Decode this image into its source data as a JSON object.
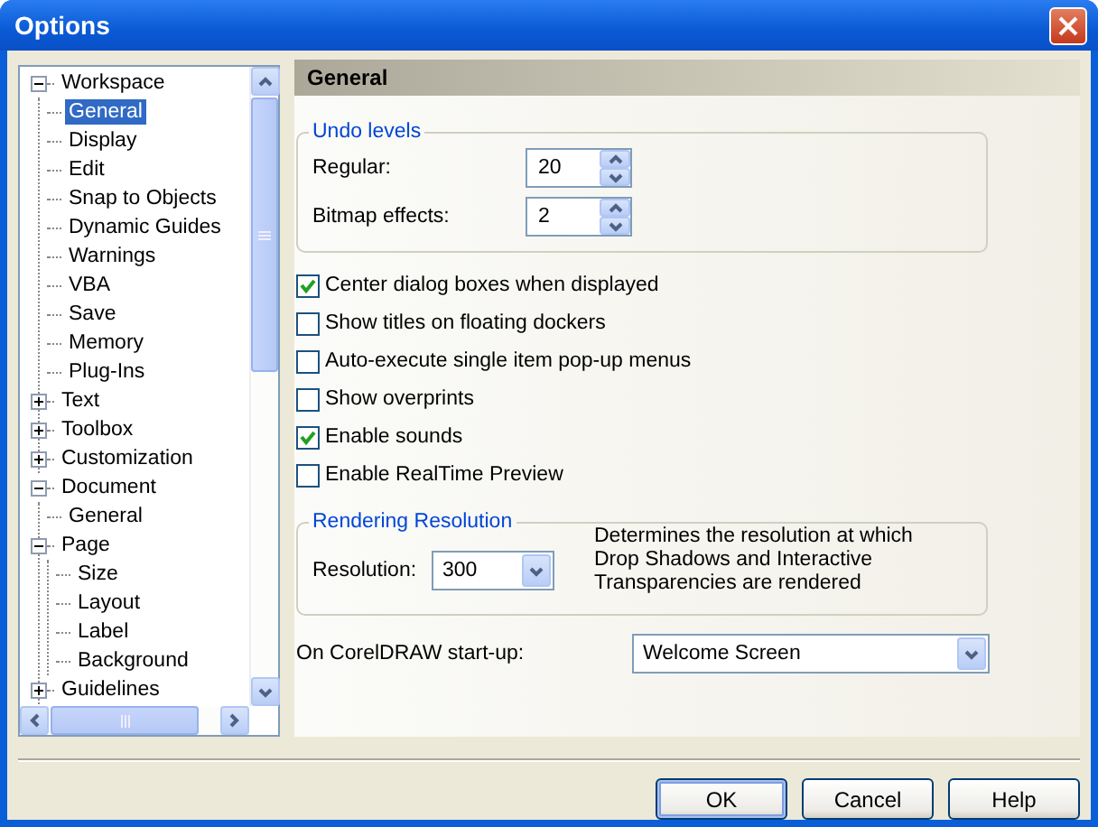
{
  "window": {
    "title": "Options"
  },
  "tree": [
    {
      "label": "Workspace",
      "expanded": true,
      "selected": false,
      "children": [
        {
          "label": "General",
          "selected": true
        },
        {
          "label": "Display",
          "selected": false
        },
        {
          "label": "Edit",
          "selected": false
        },
        {
          "label": "Snap to Objects",
          "selected": false
        },
        {
          "label": "Dynamic Guides",
          "selected": false
        },
        {
          "label": "Warnings",
          "selected": false
        },
        {
          "label": "VBA",
          "selected": false
        },
        {
          "label": "Save",
          "selected": false
        },
        {
          "label": "Memory",
          "selected": false
        },
        {
          "label": "Plug-Ins",
          "selected": false
        },
        {
          "label": "Text",
          "expanded": false,
          "selected": false
        },
        {
          "label": "Toolbox",
          "expanded": false,
          "selected": false
        },
        {
          "label": "Customization",
          "expanded": false,
          "selected": false
        }
      ]
    },
    {
      "label": "Document",
      "expanded": true,
      "selected": false,
      "children": [
        {
          "label": "General",
          "selected": false
        },
        {
          "label": "Page",
          "expanded": true,
          "selected": false,
          "children": [
            {
              "label": "Size",
              "selected": false
            },
            {
              "label": "Layout",
              "selected": false
            },
            {
              "label": "Label",
              "selected": false
            },
            {
              "label": "Background",
              "selected": false
            }
          ]
        },
        {
          "label": "Guidelines",
          "expanded": false,
          "selected": false
        }
      ]
    }
  ],
  "panel": {
    "title": "General",
    "undo_levels": {
      "title": "Undo levels",
      "fields": [
        {
          "label": "Regular:",
          "value": "20"
        },
        {
          "label": "Bitmap effects:",
          "value": "2"
        }
      ]
    },
    "checkboxes": [
      {
        "label": "Center dialog boxes when displayed",
        "checked": true
      },
      {
        "label": "Show titles on floating dockers",
        "checked": false
      },
      {
        "label": "Auto-execute single item pop-up menus",
        "checked": false
      },
      {
        "label": "Show overprints",
        "checked": false
      },
      {
        "label": "Enable sounds",
        "checked": true
      },
      {
        "label": "Enable RealTime Preview",
        "checked": false
      }
    ],
    "rendering": {
      "title": "Rendering Resolution",
      "label": "Resolution:",
      "value": "300",
      "description": "Determines the resolution at which Drop Shadows and Interactive Transparencies are rendered"
    },
    "startup": {
      "label": "On CorelDRAW start-up:",
      "value": "Welcome Screen"
    }
  },
  "buttons": [
    {
      "label": "OK",
      "default": true
    },
    {
      "label": "Cancel",
      "default": false
    },
    {
      "label": "Help",
      "default": false
    }
  ]
}
